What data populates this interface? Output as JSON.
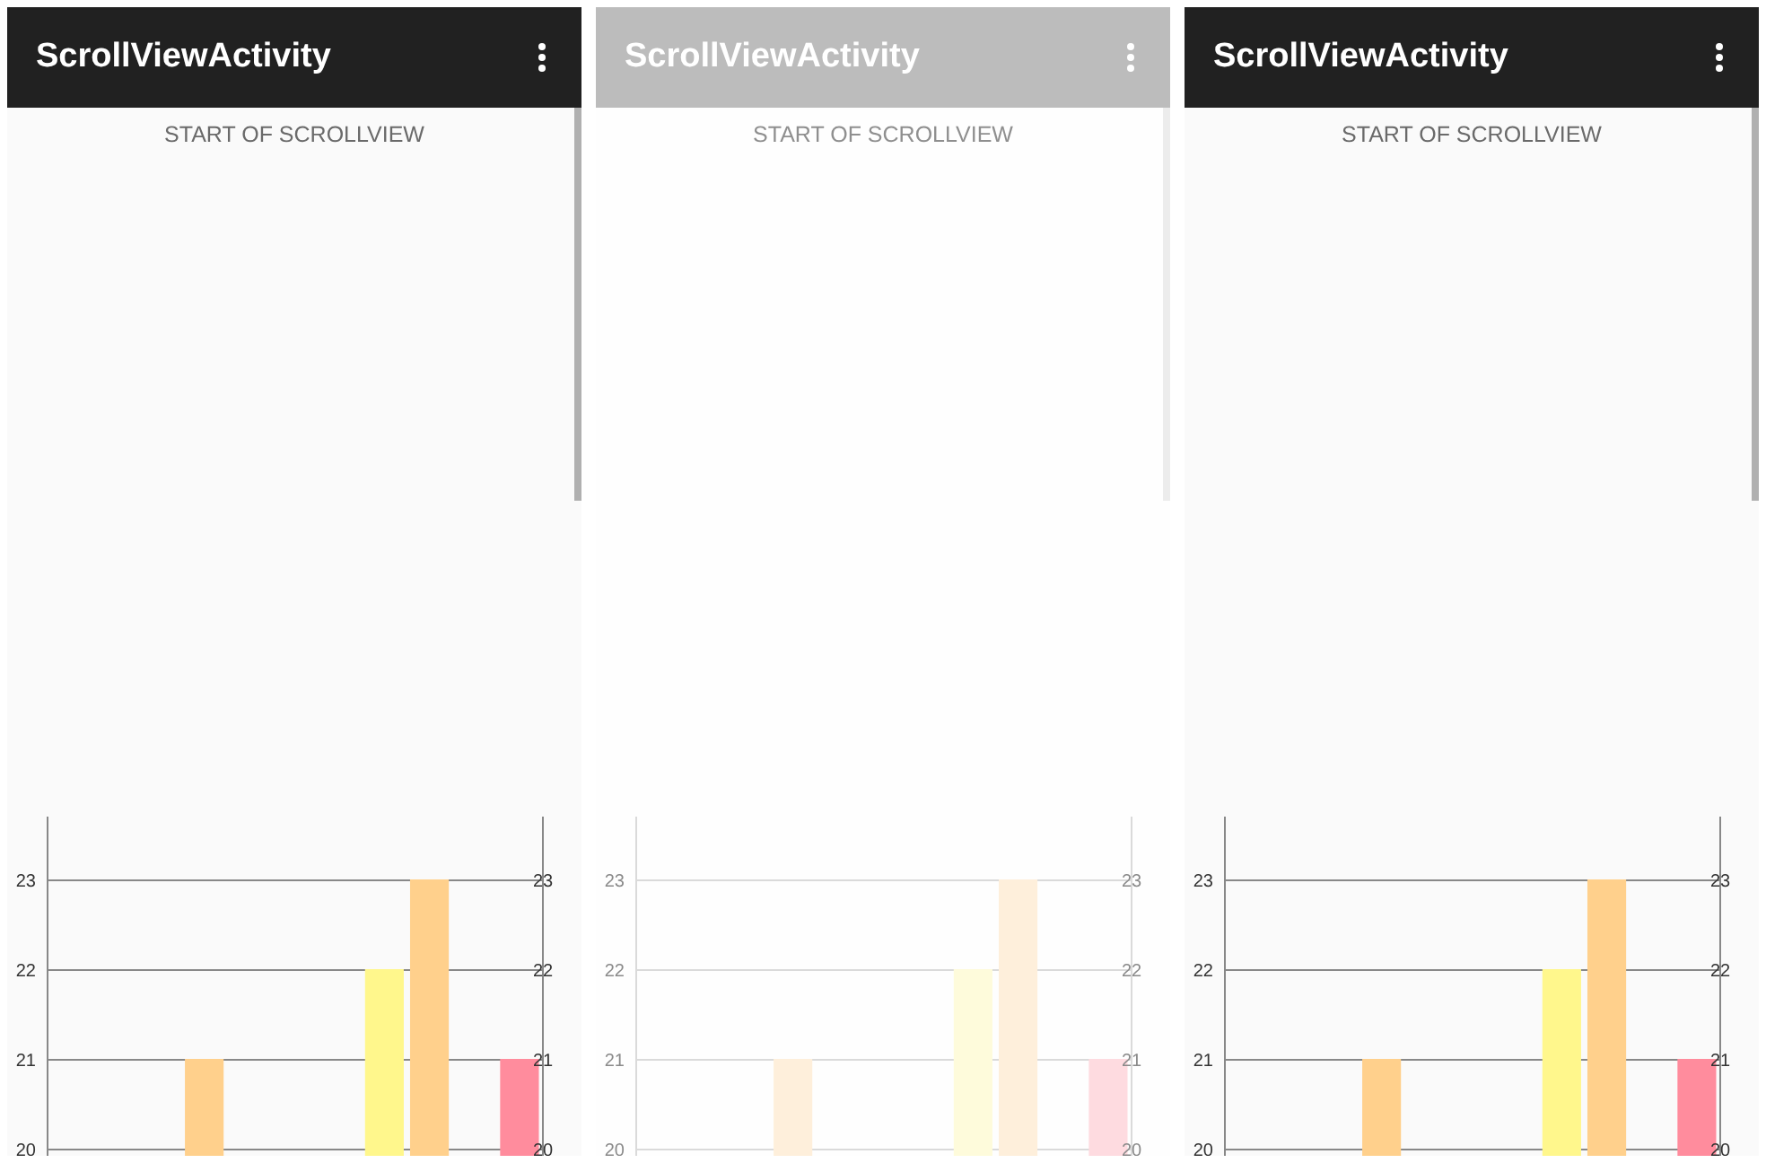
{
  "screens": [
    {
      "faded": false,
      "app_bar": {
        "title": "ScrollViewActivity"
      },
      "heading": "START OF SCROLLVIEW",
      "chart": {
        "chart_data": {
          "type": "bar",
          "grid": true,
          "categories": [
            null,
            null,
            null,
            null,
            null,
            null,
            null,
            null,
            null,
            null,
            null
          ],
          "ylim": [
            19.92,
            23.7
          ],
          "yticks": [
            20,
            21,
            22,
            23
          ],
          "y2lim": [
            19.92,
            23.7
          ],
          "y2ticks": [
            20,
            21,
            22,
            23
          ],
          "series": [
            {
              "color": "#ffd08c",
              "values": [
                null,
                null,
                null,
                21,
                null,
                null,
                null,
                null,
                null,
                null,
                null
              ]
            },
            {
              "color": "#fff78c",
              "values": [
                null,
                null,
                null,
                null,
                null,
                null,
                null,
                22,
                null,
                null,
                null
              ]
            },
            {
              "color": "#ffd08c",
              "values": [
                null,
                null,
                null,
                null,
                null,
                null,
                null,
                null,
                23,
                null,
                null
              ]
            },
            {
              "color": "#ff8c9d",
              "values": [
                null,
                null,
                null,
                null,
                null,
                null,
                null,
                null,
                null,
                null,
                21
              ]
            }
          ]
        }
      }
    },
    {
      "faded": true,
      "app_bar": {
        "title": "ScrollViewActivity"
      },
      "heading": "START OF SCROLLVIEW",
      "chart": {
        "chart_data": {
          "type": "bar",
          "grid": true,
          "categories": [
            null,
            null,
            null,
            null,
            null,
            null,
            null,
            null,
            null,
            null,
            null
          ],
          "ylim": [
            19.92,
            23.7
          ],
          "yticks": [
            20,
            21,
            22,
            23
          ],
          "y2lim": [
            19.92,
            23.7
          ],
          "y2ticks": [
            20,
            21,
            22,
            23
          ],
          "series": [
            {
              "color": "#ffd08c",
              "values": [
                null,
                null,
                null,
                21,
                null,
                null,
                null,
                null,
                null,
                null,
                null
              ]
            },
            {
              "color": "#fff78c",
              "values": [
                null,
                null,
                null,
                null,
                null,
                null,
                null,
                22,
                null,
                null,
                null
              ]
            },
            {
              "color": "#ffd08c",
              "values": [
                null,
                null,
                null,
                null,
                null,
                null,
                null,
                null,
                23,
                null,
                null
              ]
            },
            {
              "color": "#ff8c9d",
              "values": [
                null,
                null,
                null,
                null,
                null,
                null,
                null,
                null,
                null,
                null,
                21
              ]
            }
          ]
        }
      }
    },
    {
      "faded": false,
      "app_bar": {
        "title": "ScrollViewActivity"
      },
      "heading": "START OF SCROLLVIEW",
      "chart": {
        "chart_data": {
          "type": "bar",
          "grid": true,
          "categories": [
            null,
            null,
            null,
            null,
            null,
            null,
            null,
            null,
            null,
            null,
            null
          ],
          "ylim": [
            19.92,
            23.7
          ],
          "yticks": [
            20,
            21,
            22,
            23
          ],
          "y2lim": [
            19.92,
            23.7
          ],
          "y2ticks": [
            20,
            21,
            22,
            23
          ],
          "series": [
            {
              "color": "#ffd08c",
              "values": [
                null,
                null,
                null,
                21,
                null,
                null,
                null,
                null,
                null,
                null,
                null
              ]
            },
            {
              "color": "#fff78c",
              "values": [
                null,
                null,
                null,
                null,
                null,
                null,
                null,
                22,
                null,
                null,
                null
              ]
            },
            {
              "color": "#ffd08c",
              "values": [
                null,
                null,
                null,
                null,
                null,
                null,
                null,
                null,
                23,
                null,
                null
              ]
            },
            {
              "color": "#ff8c9d",
              "values": [
                null,
                null,
                null,
                null,
                null,
                null,
                null,
                null,
                null,
                null,
                21
              ]
            }
          ]
        }
      }
    }
  ]
}
